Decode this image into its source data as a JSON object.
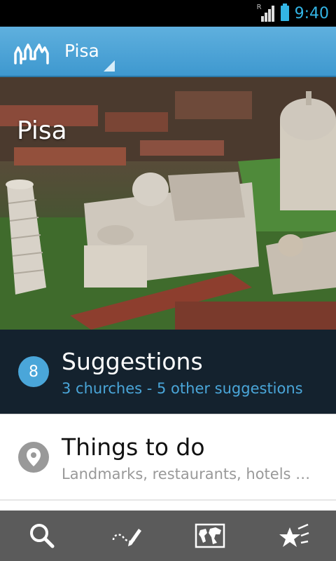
{
  "status_bar": {
    "time": "9:40",
    "roaming": "R"
  },
  "action_bar": {
    "city": "Pisa"
  },
  "hero": {
    "title": "Pisa"
  },
  "suggestions": {
    "count": "8",
    "title": "Suggestions",
    "subtitle": "3 churches - 5 other suggestions"
  },
  "things_to_do": {
    "title": "Things to do",
    "subtitle": "Landmarks, restaurants, hotels …"
  },
  "toolbar": {
    "items": [
      {
        "icon": "search-icon"
      },
      {
        "icon": "route-pencil-icon"
      },
      {
        "icon": "world-map-icon"
      },
      {
        "icon": "favorites-star-icon"
      }
    ]
  },
  "colors": {
    "accent": "#4aa6d9",
    "action_bar": "#4aa3d9",
    "dark_row": "#14222e",
    "toolbar": "#5b5b5b"
  }
}
